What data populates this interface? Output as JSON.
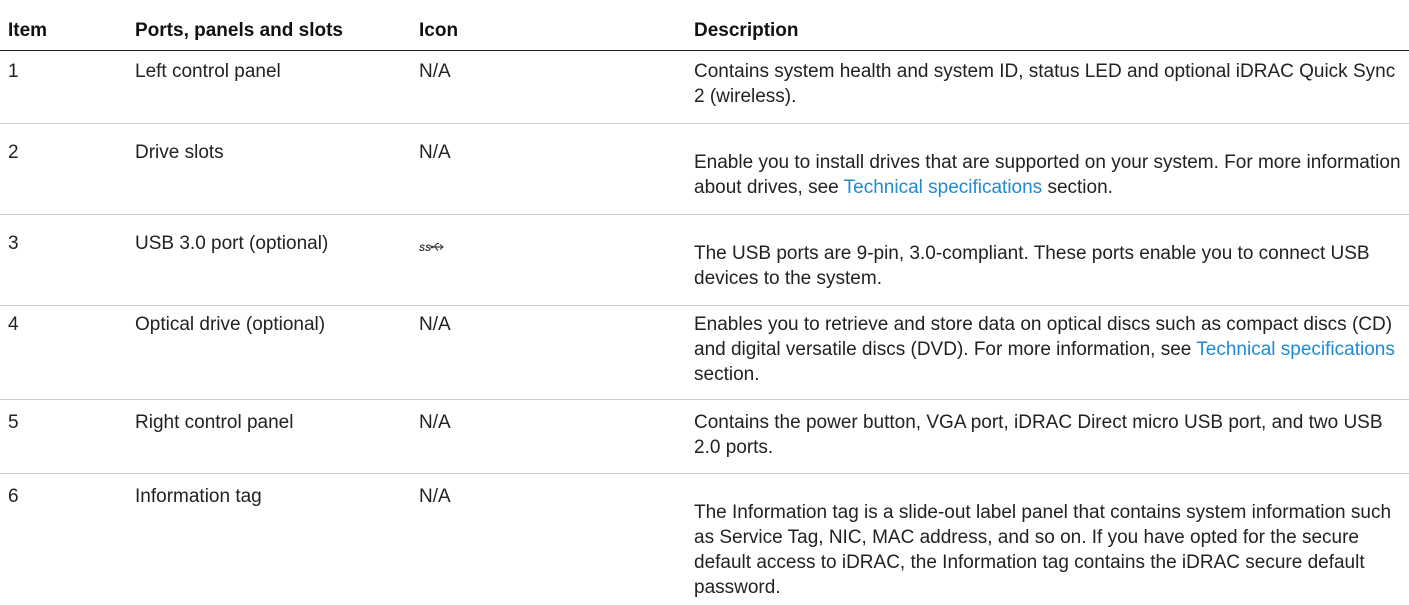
{
  "table": {
    "headers": {
      "item": "Item",
      "ports": "Ports, panels and slots",
      "icon": "Icon",
      "description": "Description"
    },
    "rows": [
      {
        "item": "1",
        "port": "Left control panel",
        "icon": "N/A",
        "desc_before": "Contains system health and system ID, status LED and optional iDRAC Quick Sync 2 (wireless).",
        "desc_link": "",
        "desc_after": ""
      },
      {
        "item": "2",
        "port": "Drive slots",
        "icon": "N/A",
        "desc_before": "Enable you to install drives that are supported on your system. For more information about drives, see ",
        "desc_link": "Technical specifications",
        "desc_after": " section."
      },
      {
        "item": "3",
        "port": "USB 3.0 port (optional)",
        "icon": "usb-superspeed-icon",
        "desc_before": "The USB ports are 9-pin, 3.0-compliant. These ports enable you to connect USB devices to the system.",
        "desc_link": "",
        "desc_after": ""
      },
      {
        "item": "4",
        "port": "Optical drive (optional)",
        "icon": "N/A",
        "desc_before": "Enables you to retrieve and store data on optical discs such as compact discs (CD) and digital versatile discs (DVD). For more information, see ",
        "desc_link": "Technical specifications",
        "desc_after": " section."
      },
      {
        "item": "5",
        "port": "Right control panel",
        "icon": "N/A",
        "desc_before": "Contains the power button, VGA port, iDRAC Direct micro USB port, and two USB 2.0 ports.",
        "desc_link": "",
        "desc_after": ""
      },
      {
        "item": "6",
        "port": "Information tag",
        "icon": "N/A",
        "desc_before": "The Information tag is a slide-out label panel that contains system information such as Service Tag, NIC, MAC address, and so on. If you have opted for the secure default access to iDRAC, the Information tag contains the iDRAC secure default password.",
        "desc_link": "",
        "desc_after": ""
      }
    ]
  },
  "colors": {
    "link": "#1f8ad2",
    "text": "#222222"
  }
}
